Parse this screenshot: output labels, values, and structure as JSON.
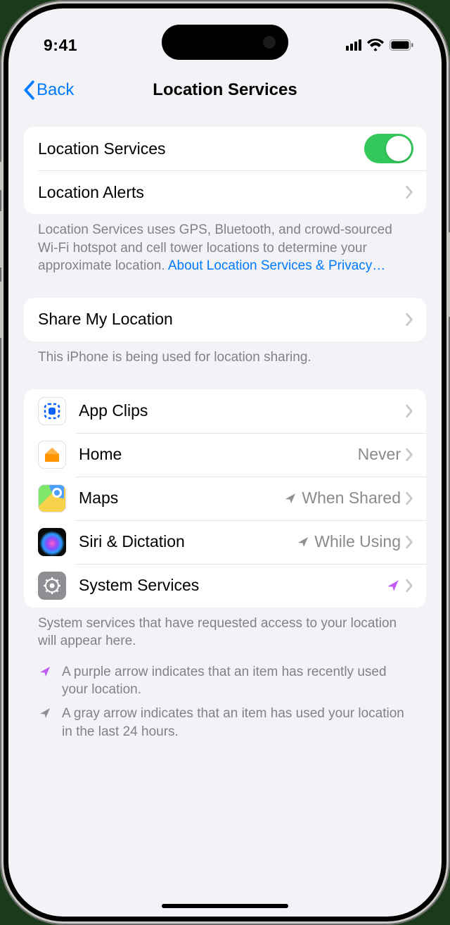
{
  "statusbar": {
    "time": "9:41"
  },
  "nav": {
    "back": "Back",
    "title": "Location Services"
  },
  "main_toggle": {
    "label": "Location Services",
    "on": true
  },
  "alerts": {
    "label": "Location Alerts"
  },
  "desc": {
    "text": "Location Services uses GPS, Bluetooth, and crowd-sourced Wi-Fi hotspot and cell tower locations to determine your approximate location. ",
    "link": "About Location Services & Privacy…"
  },
  "share": {
    "label": "Share My Location"
  },
  "share_desc": "This iPhone is being used for location sharing.",
  "apps": [
    {
      "icon": "appclips",
      "label": "App Clips",
      "detail": "",
      "arrow": ""
    },
    {
      "icon": "home",
      "label": "Home",
      "detail": "Never",
      "arrow": ""
    },
    {
      "icon": "maps",
      "label": "Maps",
      "detail": "When Shared",
      "arrow": "gray"
    },
    {
      "icon": "siri",
      "label": "Siri & Dictation",
      "detail": "While Using",
      "arrow": "gray"
    },
    {
      "icon": "system",
      "label": "System Services",
      "detail": "",
      "arrow": "purple"
    }
  ],
  "sys_desc": "System services that have requested access to your location will appear here.",
  "legend": {
    "purple": "A purple arrow indicates that an item has recently used your location.",
    "gray": "A gray arrow indicates that an item has used your location in the last 24 hours."
  },
  "colors": {
    "purple_arrow": "#bf5af2",
    "gray_arrow": "#8e8e93"
  }
}
